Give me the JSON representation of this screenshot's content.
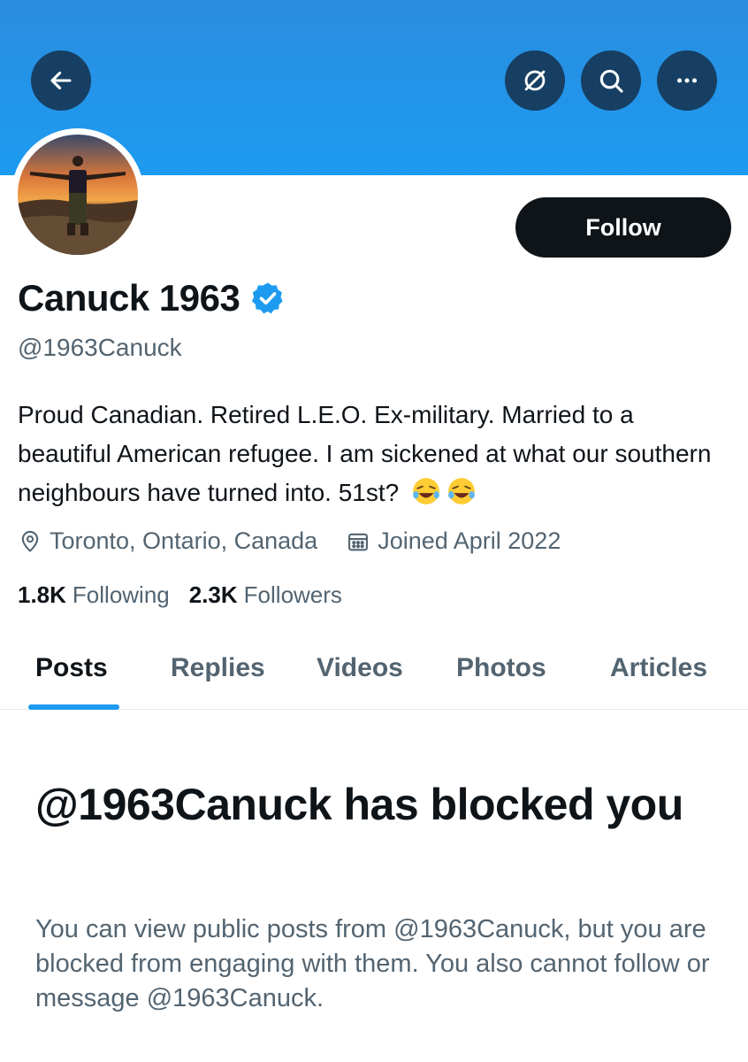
{
  "header": {
    "back_icon": "arrow-left-icon",
    "grok_icon": "grok-icon",
    "search_icon": "search-icon",
    "more_icon": "more-horizontal-icon",
    "banner_color": "#1d9bf0"
  },
  "profile": {
    "display_name": "Canuck 1963",
    "verified_icon": "verified-badge-icon",
    "handle": "@1963Canuck",
    "follow_label": "Follow",
    "bio": "Proud Canadian. Retired L.E.O. Ex-military. Married to a beautiful American refugee. I am sickened at what our southern neighbours have turned into. 51st?",
    "bio_emojis": "🤣🤣",
    "location_icon": "location-pin-icon",
    "location": "Toronto, Ontario, Canada",
    "joined_icon": "calendar-icon",
    "joined": "Joined April 2022",
    "following_count": "1.8K",
    "following_label": "Following",
    "followers_count": "2.3K",
    "followers_label": "Followers"
  },
  "tabs": [
    {
      "label": "Posts",
      "active": true
    },
    {
      "label": "Replies",
      "active": false
    },
    {
      "label": "Videos",
      "active": false
    },
    {
      "label": "Photos",
      "active": false
    },
    {
      "label": "Articles",
      "active": false
    }
  ],
  "blocked": {
    "title": "@1963Canuck has blocked you",
    "description": "You can view public posts from @1963Canuck, but you are blocked from engaging with them. You also cannot follow or message @1963Canuck."
  },
  "colors": {
    "accent": "#1d9bf0",
    "text_primary": "#0f1419",
    "text_secondary": "#536471",
    "header_button_bg": "#173f63"
  }
}
